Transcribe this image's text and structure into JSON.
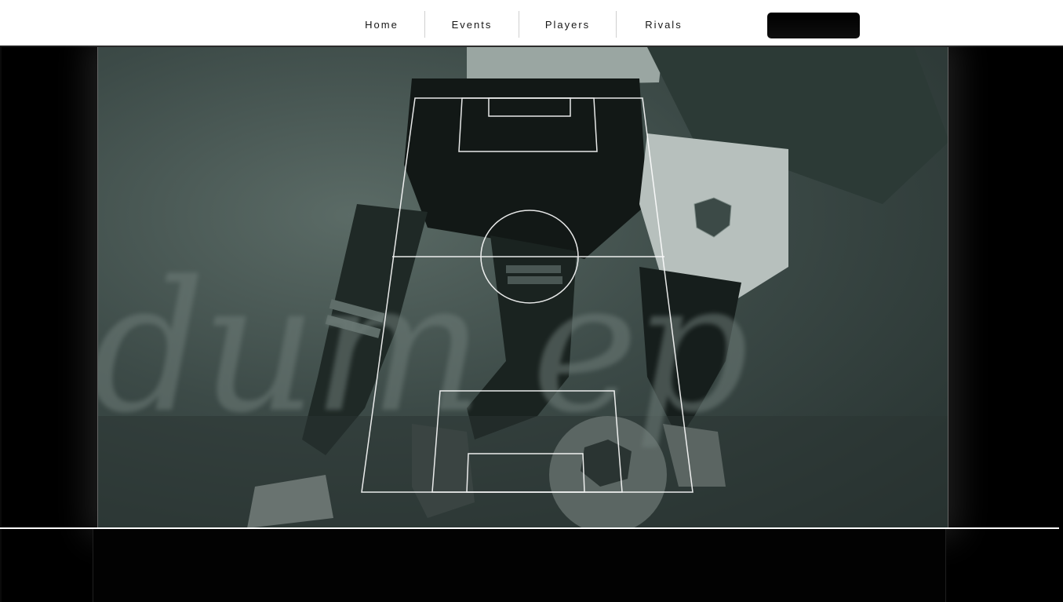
{
  "nav": {
    "items": [
      {
        "label": "Home",
        "name": "nav-home"
      },
      {
        "label": "Events",
        "name": "nav-events"
      },
      {
        "label": "Players",
        "name": "nav-players"
      },
      {
        "label": "Rivals",
        "name": "nav-rivals"
      }
    ]
  },
  "hero": {
    "image": "soccer-players-background",
    "overlay_color": "#3c4a47"
  },
  "colors": {
    "topbar": "#ffffff",
    "page_background": "#000000",
    "pitch_lines": "#ffffff",
    "cta_button": "#000000"
  }
}
